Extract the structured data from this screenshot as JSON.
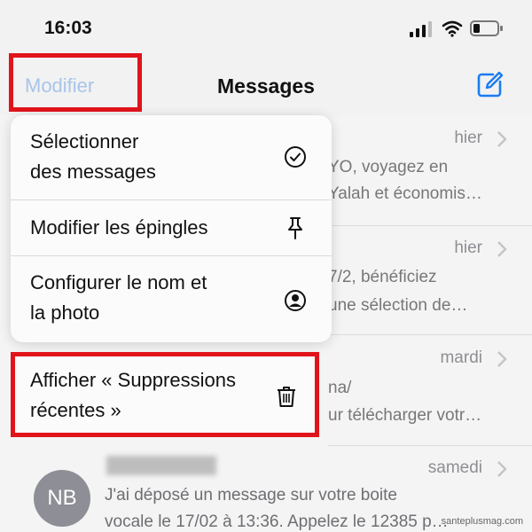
{
  "status_bar": {
    "time": "16:03"
  },
  "nav": {
    "edit_label": "Modifier",
    "title": "Messages"
  },
  "menu": {
    "items": [
      {
        "label": "Sélectionner\ndes messages",
        "icon": "checkmark-circle-icon"
      },
      {
        "label": "Modifier les épingles",
        "icon": "pin-icon"
      },
      {
        "label": "Configurer le nom et\nla photo",
        "icon": "person-circle-icon"
      }
    ],
    "delete_item": {
      "label": "Afficher « Suppressions\nrécentes »",
      "icon": "trash-icon"
    }
  },
  "messages": [
    {
      "date": "hier",
      "line1": "YO, voyagez en",
      "line2": "Yalah et économis…"
    },
    {
      "date": "hier",
      "line1": "7/2, bénéficiez",
      "line2": "une sélection de…"
    },
    {
      "date": "mardi",
      "line1": "na/",
      "line2": "ur télécharger votr…"
    },
    {
      "date": "samedi",
      "avatar": "NB",
      "line1": "J'ai déposé un message sur votre boite",
      "line2": "vocale le 17/02 à 13:36. Appelez le 12385 p…"
    }
  ],
  "watermark": "santeplusmag.com",
  "colors": {
    "ios_blue": "#1a7cf0",
    "highlight_red": "#e1141b",
    "avatar_gray": "#8e8e96"
  }
}
